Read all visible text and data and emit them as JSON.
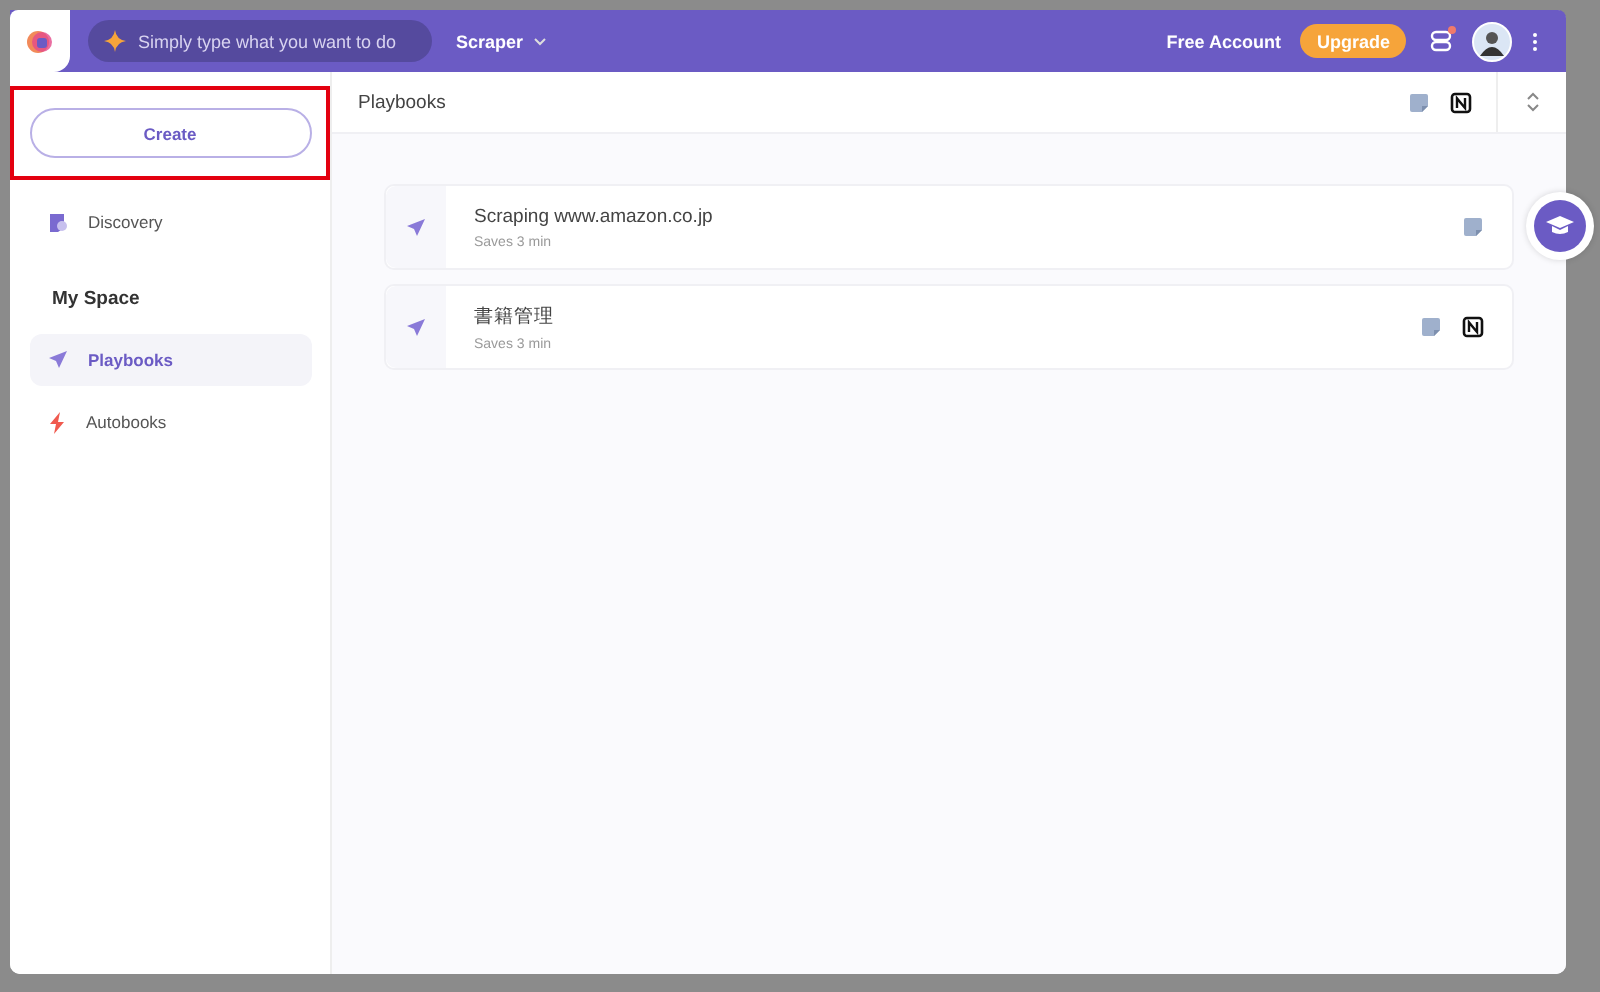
{
  "header": {
    "search": {
      "placeholder": "Simply type what you want to do"
    },
    "mode": "Scraper",
    "account": "Free Account",
    "upgrade": "Upgrade",
    "notification": true
  },
  "sidebar": {
    "create": "Create",
    "create_highlighted": true,
    "discovery": "Discovery",
    "section": "My Space",
    "items": [
      {
        "label": "Playbooks",
        "kind": "playbooks",
        "selected": true
      },
      {
        "label": "Autobooks",
        "kind": "autobooks",
        "selected": false
      }
    ]
  },
  "main": {
    "title": "Playbooks",
    "integrations": [
      {
        "kind": "note"
      },
      {
        "kind": "notion"
      }
    ],
    "playbooks": [
      {
        "title": "Scraping www.amazon.co.jp",
        "subtitle": "Saves 3 min",
        "integrations": [
          {
            "kind": "note"
          }
        ]
      },
      {
        "title": "書籍管理",
        "subtitle": "Saves 3 min",
        "integrations": [
          {
            "kind": "note"
          },
          {
            "kind": "notion"
          }
        ]
      }
    ]
  }
}
